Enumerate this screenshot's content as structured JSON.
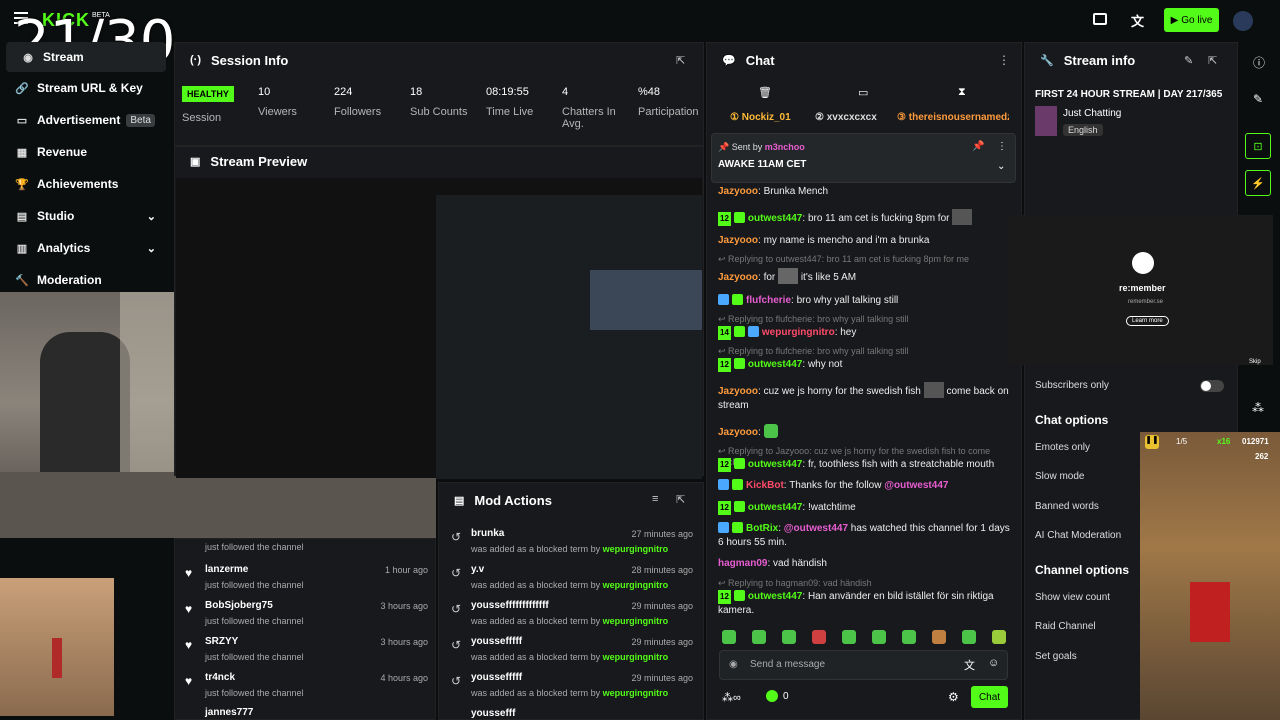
{
  "topbar": {
    "logo": "KICK",
    "beta": "BETA",
    "go_live": "Go live"
  },
  "counter": "21/30",
  "sidebar": {
    "items": [
      {
        "label": "Stream",
        "icon": "stream-icon"
      },
      {
        "label": "Stream URL & Key",
        "icon": "link-icon"
      },
      {
        "label": "Advertisement",
        "icon": "ad-icon",
        "badge": "Beta"
      },
      {
        "label": "Revenue",
        "icon": "revenue-icon"
      },
      {
        "label": "Achievements",
        "icon": "trophy-icon"
      },
      {
        "label": "Studio",
        "icon": "studio-icon"
      },
      {
        "label": "Analytics",
        "icon": "analytics-icon"
      },
      {
        "label": "Moderation",
        "icon": "moderation-icon"
      }
    ]
  },
  "session": {
    "title": "Session Info",
    "status": "HEALTHY",
    "status_label": "Session",
    "stats": [
      {
        "value": "10",
        "label": "Viewers"
      },
      {
        "value": "224",
        "label": "Followers"
      },
      {
        "value": "18",
        "label": "Sub Counts"
      },
      {
        "value": "08:19:55",
        "label": "Time Live"
      },
      {
        "value": "4",
        "label": "Chatters In Avg."
      },
      {
        "value": "%48",
        "label": "Participation"
      }
    ]
  },
  "preview": {
    "title": "Stream Preview"
  },
  "follows": [
    {
      "name": "",
      "status": "just followed the channel",
      "time": ""
    },
    {
      "name": "lanzerme",
      "status": "just followed the channel",
      "time": "1 hour ago"
    },
    {
      "name": "BobSjoberg75",
      "status": "just followed the channel",
      "time": "3 hours ago"
    },
    {
      "name": "SRZYY",
      "status": "just followed the channel",
      "time": "3 hours ago"
    },
    {
      "name": "tr4nck",
      "status": "just followed the channel",
      "time": "4 hours ago"
    },
    {
      "name": "jannes777",
      "status": "",
      "time": ""
    }
  ],
  "mod": {
    "title": "Mod Actions",
    "rows": [
      {
        "term": "brunka",
        "text": "was added as a blocked term by",
        "by": "wepurgingnitro",
        "time": "27 minutes ago"
      },
      {
        "term": "y.v",
        "text": "was added as a blocked term by",
        "by": "wepurgingnitro",
        "time": "28 minutes ago"
      },
      {
        "term": "youssefffffffffffff",
        "text": "was added as a blocked term by",
        "by": "wepurgingnitro",
        "time": "29 minutes ago"
      },
      {
        "term": "youssefffff",
        "text": "was added as a blocked term by",
        "by": "wepurgingnitro",
        "time": "29 minutes ago"
      },
      {
        "term": "youssefffff",
        "text": "was added as a blocked term by",
        "by": "wepurgingnitro",
        "time": "29 minutes ago"
      },
      {
        "term": "youssefff",
        "text": "",
        "by": "",
        "time": ""
      }
    ]
  },
  "chat": {
    "title": "Chat",
    "top_gifters": [
      "Nockiz_01",
      "xvxcxcxcx",
      "thereisnousernamedz"
    ],
    "pinned": {
      "sent_by": "Sent by",
      "user": "m3nchoo",
      "message": "AWAKE 11AM CET"
    },
    "messages": [
      {
        "user": "Jazyooo",
        "text": "Brunka Mench"
      },
      {
        "user": "outwest447",
        "text": "bro 11 am cet is fucking 8pm for"
      },
      {
        "user": "Jazyooo",
        "text": "my name is mencho and i'm a brunka"
      },
      {
        "reply": "Replying to outwest447: bro 11 am cet is fucking 8pm for me"
      },
      {
        "user": "Jazyooo",
        "text": "for",
        "text2": "it's like 5 AM"
      },
      {
        "user": "flufcherie",
        "text": "bro why yall talking still"
      },
      {
        "reply": "Replying to flufcherie: bro why yall talking still"
      },
      {
        "user": "wepurgingnitro",
        "text": "hey"
      },
      {
        "reply": "Replying to flufcherie: bro why yall talking still"
      },
      {
        "user": "outwest447",
        "text": "why not"
      },
      {
        "user": "Jazyooo",
        "text": "cuz we js horny for the swedish fish",
        "text2": "come back on stream"
      },
      {
        "user": "Jazyooo",
        "text": ""
      },
      {
        "reply": "Replying to Jazyooo: cuz we js horny for the swedish fish to come back..."
      },
      {
        "user": "outwest447",
        "text": "fr, toothless fish with a streatchable mouth"
      },
      {
        "user": "KickBot",
        "text": "Thanks for the follow",
        "mention": "@outwest447"
      },
      {
        "user": "outwest447",
        "text": "!watchtime"
      },
      {
        "user": "BotRix",
        "mention": "@outwest447",
        "text": "has watched this channel for 1 days 6 hours 55 min."
      },
      {
        "user": "hagman09",
        "text": "vad händish"
      },
      {
        "reply": "Replying to hagman09: vad händish"
      },
      {
        "user": "outwest447",
        "text": "Han använder en bild istället för sin riktiga kamera."
      }
    ],
    "input_placeholder": "Send a message",
    "footer_count": "0",
    "send": "Chat",
    "badge12": "12",
    "badge14": "14"
  },
  "streaminfo": {
    "title": "Stream info",
    "stream_title": "FIRST 24 HOUR STREAM | DAY 217/365",
    "category": "Just Chatting",
    "language": "English",
    "ad": {
      "brand": "re:member",
      "site": "remember.se",
      "cta": "Learn more",
      "skip": "Skip"
    },
    "subscribers_only": "Subscribers only",
    "chat_options": "Chat options",
    "chat_opts": [
      "Emotes only",
      "Slow mode",
      "Banned words",
      "AI Chat Moderation"
    ],
    "channel_options": "Channel options",
    "channel_opts": [
      "Show view count",
      "Raid Channel",
      "Set goals"
    ]
  },
  "game": {
    "multiplier": "x16",
    "score": "012971",
    "coins": "262",
    "lives": "1/5"
  },
  "colors": {
    "accent": "#53fc18",
    "panel": "#17191c",
    "bg": "#0b0e0f"
  }
}
